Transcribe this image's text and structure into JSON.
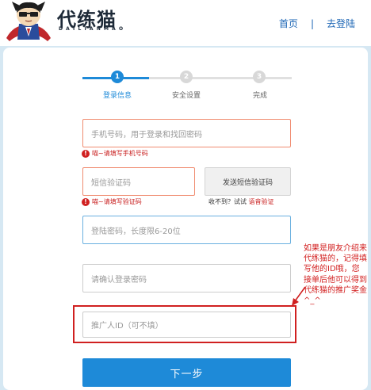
{
  "header": {
    "logo_title": "代练猫",
    "logo_subtitle": "DAILIANMAO",
    "nav_home": "首页",
    "nav_separator": "|",
    "nav_login": "去登陆"
  },
  "steps": [
    {
      "number": "1",
      "label": "登录信息",
      "state": "active"
    },
    {
      "number": "2",
      "label": "安全设置",
      "state": "inactive"
    },
    {
      "number": "3",
      "label": "完成",
      "state": "inactive"
    }
  ],
  "form": {
    "phone_placeholder": "手机号码，用于登录和找回密码",
    "phone_error": "喵~请填写手机号码",
    "sms_placeholder": "短信验证码",
    "sms_error": "喵~请填写验证码",
    "sms_button": "发送短信验证码",
    "voice_prompt": "收不到？试试",
    "voice_link": "语音验证",
    "password_placeholder": "登陆密码，长度限6-20位",
    "confirm_placeholder": "请确认登录密码",
    "referrer_placeholder": "推广人ID（可不填）",
    "submit_label": "下一步"
  },
  "annotation": {
    "note": "如果是朋友介绍来代练猫的，记得填写他的ID哦，您接单后他可以得到代练猫的推广奖金^_^"
  },
  "colors": {
    "accent": "#1e8ad8",
    "error": "#d02020",
    "nav": "#1a64b4",
    "background": "#d6e8f3"
  }
}
